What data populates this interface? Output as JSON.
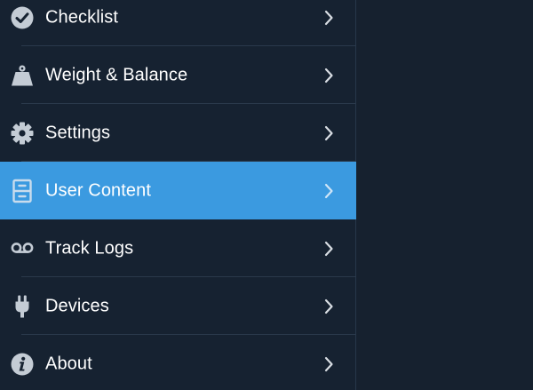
{
  "menu": {
    "items": [
      {
        "label": "Checklist",
        "icon": "checkmark-circle-icon",
        "selected": false
      },
      {
        "label": "Weight & Balance",
        "icon": "weight-icon",
        "selected": false
      },
      {
        "label": "Settings",
        "icon": "gear-icon",
        "selected": false
      },
      {
        "label": "User Content",
        "icon": "file-cabinet-icon",
        "selected": true
      },
      {
        "label": "Track Logs",
        "icon": "voicemail-icon",
        "selected": false
      },
      {
        "label": "Devices",
        "icon": "plug-icon",
        "selected": false
      },
      {
        "label": "About",
        "icon": "info-circle-icon",
        "selected": false
      }
    ]
  },
  "colors": {
    "background": "#16212f",
    "selected": "#3b9ae0",
    "icon": "#c4ccd5",
    "text": "#ffffff"
  }
}
